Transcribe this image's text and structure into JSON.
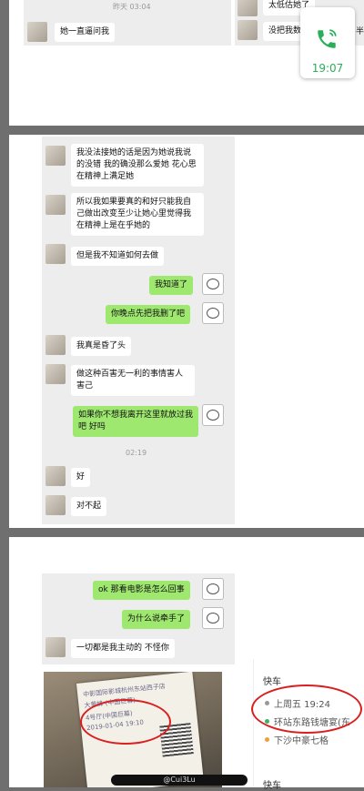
{
  "page1": {
    "time_top": "昨天 03:04",
    "left_message": "她一直逼问我",
    "right_message_1": "太低估她了",
    "right_message_2": "没把我数",
    "right_message_2_tail": "半"
  },
  "call_widget": {
    "time": "19:07"
  },
  "page2": {
    "messages": [
      {
        "from": "other",
        "text": "我没法接她的话是因为她说我说的没错 我的确没那么爱她 花心思在精神上满足她"
      },
      {
        "from": "other",
        "text": "所以我如果要真的和好只能我自己做出改变至少让她心里觉得我在精神上是在乎她的"
      },
      {
        "from": "other",
        "text": "但是我不知道如何去做"
      },
      {
        "from": "me",
        "text": "我知道了"
      },
      {
        "from": "me",
        "text": "你晚点先把我删了吧"
      },
      {
        "from": "other",
        "text": "我真是昏了头"
      },
      {
        "from": "other",
        "text": "做这种百害无一利的事情害人害己"
      },
      {
        "from": "me",
        "text": "如果你不想我离开这里就放过我吧 好吗"
      },
      {
        "from": "other",
        "text": "好"
      },
      {
        "from": "other",
        "text": "对不起"
      }
    ],
    "time_mid": "02:19"
  },
  "page3": {
    "messages": [
      {
        "from": "me",
        "text": "ok 那看电影是怎么回事"
      },
      {
        "from": "me",
        "text": "为什么说牵手了"
      },
      {
        "from": "other",
        "text": "一切都是我主动的 不怪你"
      }
    ],
    "ticket_lines": [
      "中影国际影城杭州东站西子店",
      "大黄蜂 (中国巨幕)",
      "4号厅(中国巨幕)",
      "2019-01-04 19:10"
    ],
    "trip": {
      "title": "快车",
      "time": "上周五 19:24",
      "from": "环站东路钱塘宴(东",
      "to": "下沙中豪七格",
      "title2": "快车"
    },
    "watermark": "@Cui3Lu"
  }
}
